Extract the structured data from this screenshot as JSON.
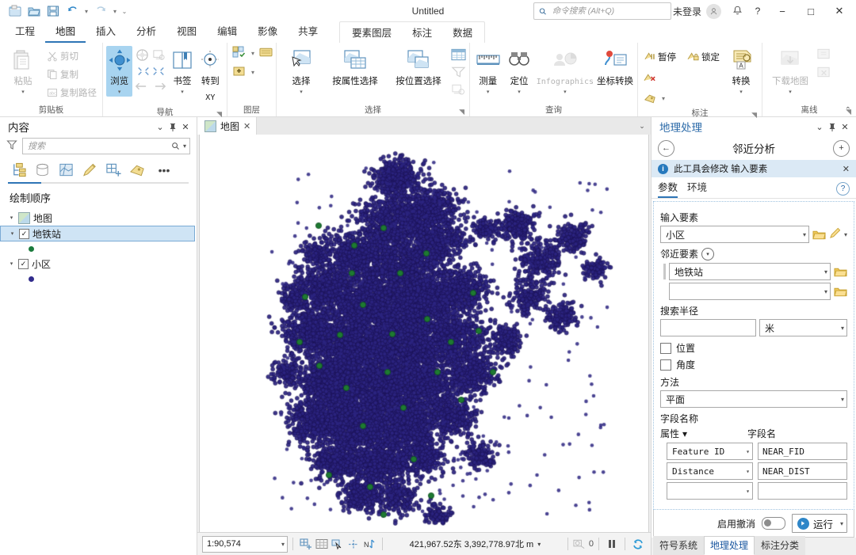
{
  "window": {
    "title": "Untitled",
    "search_placeholder": "命令搜索 (Alt+Q)",
    "account_label": "未登录",
    "minimize": "−",
    "maximize": "□",
    "close": "✕"
  },
  "quick_access": [
    {
      "name": "new-project-icon",
      "label": ""
    },
    {
      "name": "open-project-icon",
      "label": ""
    },
    {
      "name": "save-project-icon",
      "label": ""
    },
    {
      "name": "undo-icon",
      "label": "↶"
    },
    {
      "name": "redo-icon",
      "label": "↷"
    },
    {
      "name": "customize-qat-icon",
      "label": "⌄"
    }
  ],
  "ribbon": {
    "tabs": [
      {
        "label": "工程",
        "active": false
      },
      {
        "label": "地图",
        "active": true
      },
      {
        "label": "插入",
        "active": false
      },
      {
        "label": "分析",
        "active": false
      },
      {
        "label": "视图",
        "active": false
      },
      {
        "label": "编辑",
        "active": false
      },
      {
        "label": "影像",
        "active": false
      },
      {
        "label": "共享",
        "active": false
      }
    ],
    "context_tabs": [
      {
        "label": "要素图层",
        "active": false
      },
      {
        "label": "标注",
        "active": false
      },
      {
        "label": "数据",
        "active": false
      }
    ],
    "groups": {
      "clipboard": {
        "label": "剪贴板",
        "paste": "粘贴",
        "cut": "剪切",
        "copy": "复制",
        "copy_path": "复制路径"
      },
      "navigate": {
        "label": "导航",
        "explore": "浏览",
        "bookmarks": "书签",
        "goto_xy": "转到",
        "goto_xy2": "XY"
      },
      "layer": {
        "label": "图层"
      },
      "selection": {
        "label": "选择",
        "select": "选择",
        "select_by_attributes": "按属性选择",
        "select_by_location": "按位置选择"
      },
      "inquiry": {
        "label": "查询",
        "measure": "测量",
        "locate": "定位",
        "infographics": "Infographics",
        "coordinate_conversion": "坐标转换"
      },
      "labeling": {
        "label": "标注",
        "pause": "暂停",
        "lock": "锁定",
        "convert": "转换"
      },
      "offline": {
        "label": "离线",
        "download_map": "下载地图"
      }
    },
    "collapse_caret": "⌃"
  },
  "contents": {
    "title": "内容",
    "filter_placeholder": "搜索",
    "tabs": [
      {
        "name": "list-by-drawing-order-icon"
      },
      {
        "name": "list-by-data-source-icon"
      },
      {
        "name": "list-by-selection-icon"
      },
      {
        "name": "list-by-editing-icon"
      },
      {
        "name": "list-by-snapping-icon"
      },
      {
        "name": "list-by-labeling-icon"
      },
      {
        "name": "more-options-icon"
      }
    ],
    "section_title": "绘制顺序",
    "tree": [
      {
        "label": "地图",
        "type": "map",
        "expanded": true
      },
      {
        "label": "地铁站",
        "type": "layer",
        "checked": true,
        "selected": true,
        "symbol_color": "#1a7a3c"
      },
      {
        "label": "小区",
        "type": "layer",
        "checked": true,
        "selected": false,
        "symbol_color": "#312c8c"
      }
    ]
  },
  "map": {
    "tab_label": "地图",
    "tab_close": "✕",
    "status": {
      "scale": "1:90,574",
      "coordinates": "421,967.52东  3,392,778.97北  m",
      "selection_count": "0"
    },
    "points": {
      "community_color": "#2b2480",
      "station_color": "#1f7a32"
    }
  },
  "geoprocessing": {
    "panel_title": "地理处理",
    "tool_title": "邻近分析",
    "message": "此工具会修改 输入要素",
    "tabs": [
      {
        "label": "参数",
        "active": true
      },
      {
        "label": "环境",
        "active": false
      }
    ],
    "help": "?",
    "fields": {
      "input_features_label": "输入要素",
      "input_features_value": "小区",
      "near_features_label": "邻近要素",
      "near_features_value": "地铁站",
      "near_features_value2": "",
      "search_radius_label": "搜索半径",
      "search_radius_value": "",
      "search_radius_unit": "米",
      "location_label": "位置",
      "angle_label": "角度",
      "method_label": "方法",
      "method_value": "平面",
      "field_names_label": "字段名称",
      "attribute_col": "属性",
      "fieldname_col": "字段名",
      "rows": [
        {
          "attribute": "Feature ID",
          "field_name": "NEAR_FID"
        },
        {
          "attribute": "Distance",
          "field_name": "NEAR_DIST"
        },
        {
          "attribute": "",
          "field_name": ""
        }
      ]
    },
    "footer": {
      "enable_undo": "启用撤消",
      "run_label": "运行"
    },
    "bottom_tabs": [
      {
        "label": "符号系统",
        "active": false
      },
      {
        "label": "地理处理",
        "active": true
      },
      {
        "label": "标注分类",
        "active": false
      }
    ]
  }
}
